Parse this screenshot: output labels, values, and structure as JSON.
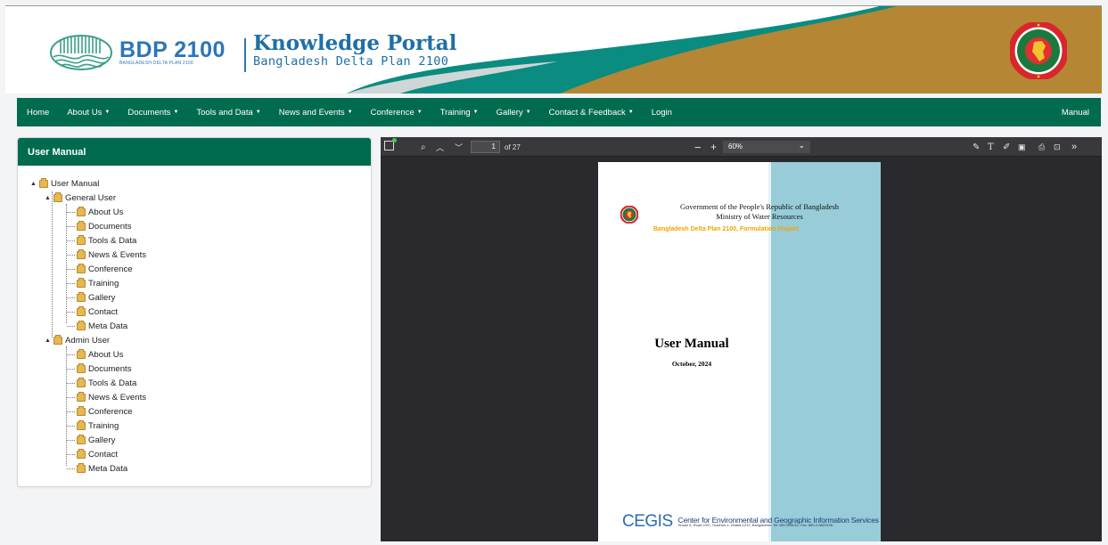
{
  "header": {
    "bdp_title": "BDP 2100",
    "bdp_subtitle": "BANGLADESH DELTA PLAN 2100",
    "portal_title": "Knowledge Portal",
    "portal_subtitle": "Bangladesh Delta Plan 2100",
    "colors": {
      "teal": "#0a8c80",
      "gold": "#b58634",
      "brand_blue": "#2a76b8"
    }
  },
  "nav": {
    "items": [
      {
        "label": "Home",
        "dropdown": false
      },
      {
        "label": "About Us",
        "dropdown": true
      },
      {
        "label": "Documents",
        "dropdown": true
      },
      {
        "label": "Tools and Data",
        "dropdown": true
      },
      {
        "label": "News and Events",
        "dropdown": true
      },
      {
        "label": "Conference",
        "dropdown": true
      },
      {
        "label": "Training",
        "dropdown": true
      },
      {
        "label": "Gallery",
        "dropdown": true
      },
      {
        "label": "Contact & Feedback",
        "dropdown": true
      },
      {
        "label": "Login",
        "dropdown": false
      }
    ],
    "right_label": "Manual",
    "color": "#006b4f"
  },
  "panel": {
    "title": "User Manual",
    "tree": {
      "root": "User Manual",
      "general": {
        "label": "General User",
        "children": [
          "About Us",
          "Documents",
          "Tools & Data",
          "News & Events",
          "Conference",
          "Training",
          "Gallery",
          "Contact",
          "Meta Data"
        ]
      },
      "admin": {
        "label": "Admin User",
        "children": [
          "About Us",
          "Documents",
          "Tools & Data",
          "News & Events",
          "Conference",
          "Training",
          "Gallery",
          "Contact",
          "Meta Data"
        ]
      }
    }
  },
  "viewer": {
    "page_number": "1",
    "page_count": "of 27",
    "zoom": "60%",
    "icons": [
      "sidebar-toggle-icon",
      "search-icon",
      "prev-page-icon",
      "next-page-icon",
      "zoom-out-icon",
      "zoom-in-icon",
      "highlight-icon",
      "text-icon",
      "draw-icon",
      "image-icon",
      "print-icon",
      "save-icon",
      "more-tools-icon"
    ]
  },
  "document": {
    "gov_line1": "Government of the People's Republic of Bangladesh",
    "gov_line2": "Ministry of Water Resources",
    "project_line": "Bangladesh Delta Plan 2100, Formulation Project",
    "title": "User Manual",
    "date": "October, 2024",
    "org_logo": "CEGIS",
    "org_name": "Center for Environmental and Geographic Information Services",
    "org_address": "House 6, Road 23/C, Gulshan-1, Dhaka-1212, Bangladesh. Tel: 8817648-52, Fax: 880-2-8823128"
  }
}
